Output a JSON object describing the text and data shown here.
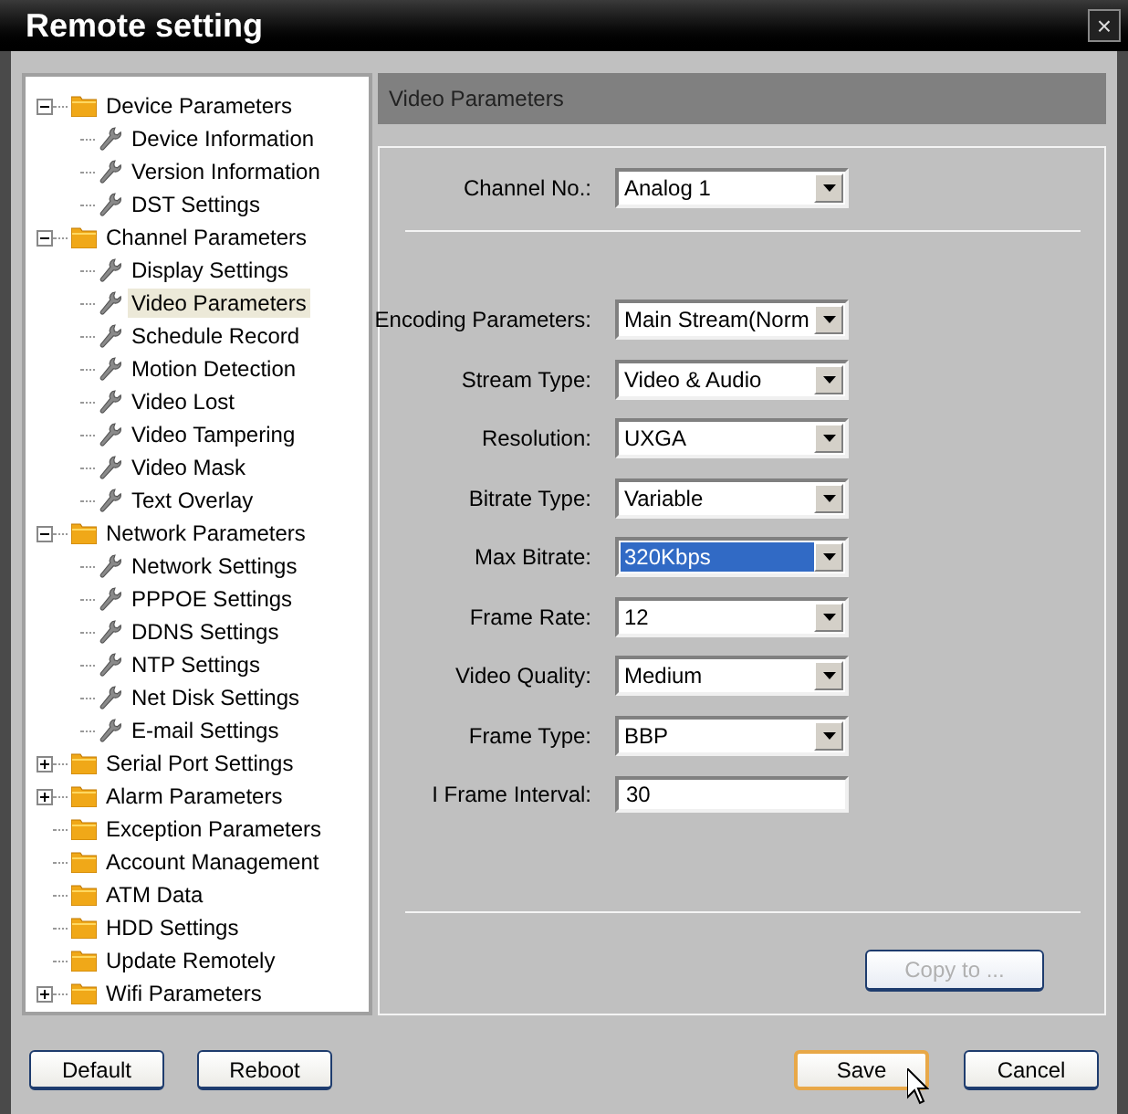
{
  "window": {
    "title": "Remote setting",
    "close": "×"
  },
  "tree": [
    {
      "label": "Device Parameters",
      "kind": "folder",
      "expanded": true,
      "selected": false,
      "children": [
        {
          "label": "Device Information",
          "kind": "setting",
          "selected": false
        },
        {
          "label": "Version Information",
          "kind": "setting",
          "selected": false
        },
        {
          "label": "DST Settings",
          "kind": "setting",
          "selected": false
        }
      ]
    },
    {
      "label": "Channel Parameters",
      "kind": "folder",
      "expanded": true,
      "selected": false,
      "children": [
        {
          "label": "Display Settings",
          "kind": "setting",
          "selected": false
        },
        {
          "label": "Video Parameters",
          "kind": "setting",
          "selected": true
        },
        {
          "label": "Schedule Record",
          "kind": "setting",
          "selected": false
        },
        {
          "label": "Motion Detection",
          "kind": "setting",
          "selected": false
        },
        {
          "label": "Video Lost",
          "kind": "setting",
          "selected": false
        },
        {
          "label": "Video Tampering",
          "kind": "setting",
          "selected": false
        },
        {
          "label": "Video Mask",
          "kind": "setting",
          "selected": false
        },
        {
          "label": "Text Overlay",
          "kind": "setting",
          "selected": false
        }
      ]
    },
    {
      "label": "Network Parameters",
      "kind": "folder",
      "expanded": true,
      "selected": false,
      "children": [
        {
          "label": "Network Settings",
          "kind": "setting",
          "selected": false
        },
        {
          "label": "PPPOE Settings",
          "kind": "setting",
          "selected": false
        },
        {
          "label": "DDNS Settings",
          "kind": "setting",
          "selected": false
        },
        {
          "label": "NTP Settings",
          "kind": "setting",
          "selected": false
        },
        {
          "label": "Net Disk Settings",
          "kind": "setting",
          "selected": false
        },
        {
          "label": "E-mail Settings",
          "kind": "setting",
          "selected": false
        }
      ]
    },
    {
      "label": "Serial Port Settings",
      "kind": "folder",
      "expanded": false,
      "selected": false
    },
    {
      "label": "Alarm Parameters",
      "kind": "folder",
      "expanded": false,
      "selected": false
    },
    {
      "label": "Exception Parameters",
      "kind": "folder",
      "selected": false
    },
    {
      "label": "Account Management",
      "kind": "folder",
      "selected": false
    },
    {
      "label": "ATM Data",
      "kind": "folder",
      "selected": false
    },
    {
      "label": "HDD Settings",
      "kind": "folder",
      "selected": false
    },
    {
      "label": "Update Remotely",
      "kind": "folder",
      "selected": false
    },
    {
      "label": "Wifi Parameters",
      "kind": "folder",
      "expanded": false,
      "selected": false
    }
  ],
  "panel": {
    "title": "Video Parameters",
    "channel": {
      "label": "Channel No.:",
      "kind": "select",
      "value": "Analog 1",
      "highlighted": false
    },
    "fields": [
      {
        "label": "Encoding Parameters:",
        "kind": "select",
        "value": "Main Stream(Norm",
        "highlighted": false
      },
      {
        "label": "Stream Type:",
        "kind": "select",
        "value": "Video & Audio",
        "highlighted": false
      },
      {
        "label": "Resolution:",
        "kind": "select",
        "value": "UXGA",
        "highlighted": false
      },
      {
        "label": "Bitrate Type:",
        "kind": "select",
        "value": "Variable",
        "highlighted": false
      },
      {
        "label": "Max Bitrate:",
        "kind": "select",
        "value": "320Kbps",
        "highlighted": true
      },
      {
        "label": "Frame Rate:",
        "kind": "select",
        "value": "12",
        "highlighted": false
      },
      {
        "label": "Video Quality:",
        "kind": "select",
        "value": "Medium",
        "highlighted": false
      },
      {
        "label": "Frame Type:",
        "kind": "select",
        "value": "BBP",
        "highlighted": false
      },
      {
        "label": "I Frame Interval:",
        "kind": "text",
        "value": "30",
        "highlighted": false
      }
    ],
    "copy_button": {
      "label": "Copy to ...",
      "disabled": true
    }
  },
  "left_buttons": [
    {
      "label": "Default",
      "focused": false
    },
    {
      "label": "Reboot",
      "focused": false
    }
  ],
  "right_buttons": [
    {
      "label": "Save",
      "focused": true,
      "hovered": true
    },
    {
      "label": "Cancel",
      "focused": false,
      "hovered": false
    }
  ]
}
